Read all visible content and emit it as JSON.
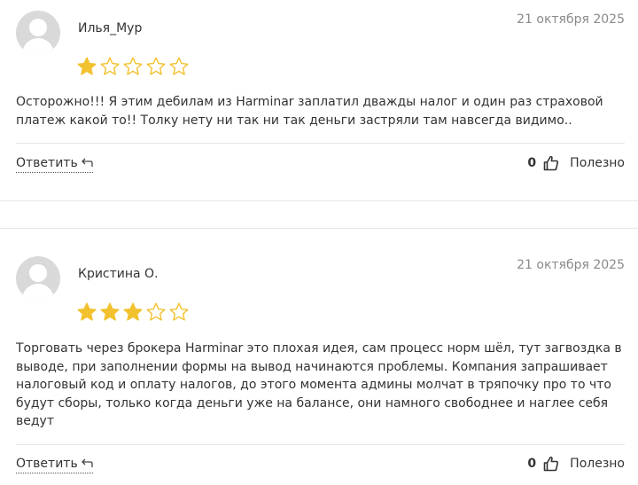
{
  "colors": {
    "star_filled": "#F2C12E",
    "star_empty": "#F2C12E",
    "date": "#8a8a8a",
    "text": "#333333"
  },
  "reviews": [
    {
      "author": "Илья_Мур",
      "date": "21 октября 2025",
      "rating": 1,
      "max_rating": 5,
      "text": "Осторожно!!! Я этим дебилам из Harminar заплатил дважды налог и один раз страховой платеж какой то!! Толку нету ни так ни так деньги застряли там навсегда видимо..",
      "reply_label": "Ответить",
      "useful_count": "0",
      "useful_label": "Полезно"
    },
    {
      "author": "Кристина О.",
      "date": "21 октября 2025",
      "rating": 3,
      "max_rating": 5,
      "text": "Торговать через брокера Harminar это плохая идея, сам процесс норм шёл, тут загвоздка в выводе, при заполнении формы на вывод начинаются проблемы. Компания запрашивает налоговый код и оплату налогов, до этого момента админы молчат в тряпочку про то что будут сборы, только когда деньги уже на балансе, они намного свободнее и наглее себя ведут",
      "reply_label": "Ответить",
      "useful_count": "0",
      "useful_label": "Полезно"
    }
  ]
}
